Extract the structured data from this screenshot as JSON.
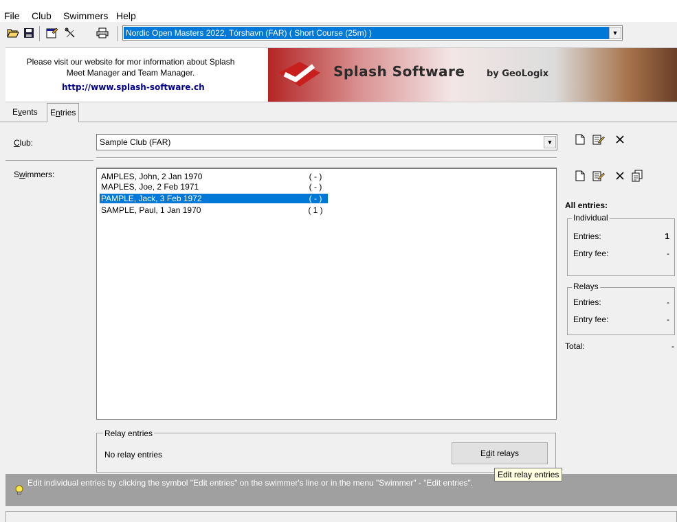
{
  "menu": {
    "file": "File",
    "club": "Club",
    "swimmers": "Swimmers",
    "help": "Help"
  },
  "toolbar": {
    "icons": [
      "open-folder-icon",
      "save-icon",
      "properties-icon",
      "tools-icon",
      "print-icon"
    ],
    "meet": "Nordic Open Masters 2022,  Tórshavn  (FAR)  ( Short Course (25m) )"
  },
  "banner": {
    "line1": "Please visit our website for mor information about Splash",
    "line2": "Meet Manager and Team Manager.",
    "link": "http://www.splash-software.ch",
    "brand": "Splash Software",
    "brand_sub": "by GeoLogix"
  },
  "tabs": {
    "events_pre": "E",
    "events_u": "v",
    "events_post": "ents",
    "entries_pre": "E",
    "entries_u": "n",
    "entries_post": "tries"
  },
  "form": {
    "club_label_u": "C",
    "club_label_rest": "lub:",
    "club_value": "Sample Club (FAR)",
    "swimmers_label_pre": "S",
    "swimmers_label_u": "w",
    "swimmers_label_post": "immers:"
  },
  "swimmers": [
    {
      "name": "AMPLES, John, 2 Jan 1970",
      "entries": "( - )",
      "selected": false
    },
    {
      "name": "MAPLES, Joe, 2 Feb 1971",
      "entries": "( - )",
      "selected": false
    },
    {
      "name": "PAMPLE, Jack, 3 Feb 1972",
      "entries": "( - )",
      "selected": true
    },
    {
      "name": "SAMPLE, Paul, 1 Jan 1970",
      "entries": "( 1 )",
      "selected": false
    }
  ],
  "relay": {
    "legend": "Relay entries",
    "none": "No relay entries",
    "button_pre": "E",
    "button_u": "d",
    "button_post": "it relays"
  },
  "right_panel": {
    "all_entries": "All entries:",
    "individual": {
      "legend": "Individual",
      "entries_label": "Entries:",
      "entries_value": "1",
      "fee_label": "Entry fee:",
      "fee_value": "-"
    },
    "relays": {
      "legend": "Relays",
      "entries_label": "Entries:",
      "entries_value": "-",
      "fee_label": "Entry fee:",
      "fee_value": "-"
    },
    "total_label": "Total:",
    "total_value": "-"
  },
  "status": {
    "text": "Edit individual entries by clicking the symbol \"Edit entries\" on the swimmer's line or in the menu \"Swimmer\" - \"Edit entries\".",
    "tooltip": "Edit relay entries"
  },
  "colors": {
    "selection": "#0078d7",
    "status_bar": "#a0a0a0",
    "link": "#00008b",
    "tooltip_bg": "#ffffe1"
  }
}
